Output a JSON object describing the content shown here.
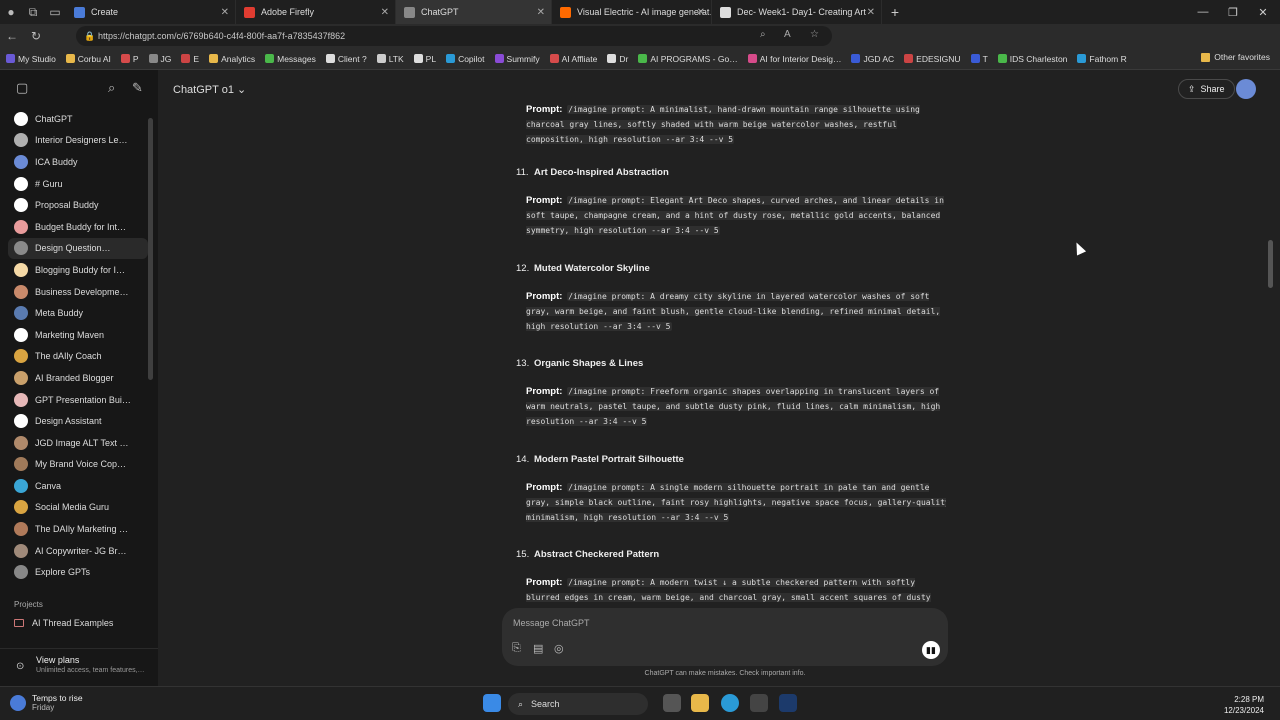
{
  "browser": {
    "tabs": [
      {
        "title": "Create",
        "color": "#4a7bd8"
      },
      {
        "title": "Adobe Firefly",
        "color": "#e03c31"
      },
      {
        "title": "ChatGPT",
        "color": "#888888"
      },
      {
        "title": "Visual Electric - AI image generat…",
        "color": "#ff6a00"
      },
      {
        "title": "Dec- Week1- Day1- Creating Art",
        "color": "#dddddd"
      }
    ],
    "url": "https://chatgpt.com/c/6769b640-c4f4-800f-aa7f-a7835437f862",
    "bookmarks": [
      "My Studio",
      "Corbu AI",
      "P",
      "JG",
      "E",
      "Analytics",
      "Messages",
      "Client ?",
      "LTK",
      "PL",
      "Copilot",
      "Summify",
      "AI Affliate",
      "Dr",
      "AI PROGRAMS - Go…",
      "AI for Interior Desig…",
      "JGD AC",
      "EDESIGNU",
      "T",
      "IDS Charleston",
      "Fathom R"
    ],
    "other_favorites": "Other favorites"
  },
  "sidebar": {
    "items": [
      {
        "label": "ChatGPT",
        "color": "#ffffff"
      },
      {
        "label": "Interior Designers Le…",
        "color": "#b0b0b0"
      },
      {
        "label": "ICA Buddy",
        "color": "#6b8bd6"
      },
      {
        "label": "# Guru",
        "color": "#ffffff"
      },
      {
        "label": "Proposal Buddy",
        "color": "#ffffff"
      },
      {
        "label": "Budget Buddy for Int…",
        "color": "#e89b9b"
      },
      {
        "label": "Design Question…",
        "color": "#8a8a8a"
      },
      {
        "label": "Blogging Buddy for I…",
        "color": "#f5d9a6"
      },
      {
        "label": "Business Developme…",
        "color": "#c98a6b"
      },
      {
        "label": "Meta Buddy",
        "color": "#5a7bb0"
      },
      {
        "label": "Marketing Maven",
        "color": "#ffffff"
      },
      {
        "label": "The dAIly Coach",
        "color": "#d9a441"
      },
      {
        "label": "AI Branded Blogger",
        "color": "#c9a06b"
      },
      {
        "label": "GPT Presentation Bui…",
        "color": "#e6b8b8"
      },
      {
        "label": "Design Assistant",
        "color": "#ffffff"
      },
      {
        "label": "JGD Image ALT Text …",
        "color": "#b08a6b"
      },
      {
        "label": "My Brand Voice Cop…",
        "color": "#a07a5a"
      },
      {
        "label": "Canva",
        "color": "#3aa6d6"
      },
      {
        "label": "Social Media Guru",
        "color": "#d9a441"
      },
      {
        "label": "The DAIly Marketing …",
        "color": "#b07a5a"
      },
      {
        "label": "AI Copywriter- JG Br…",
        "color": "#a08a7a"
      },
      {
        "label": "Explore GPTs",
        "color": "#888888"
      }
    ],
    "projects_label": "Projects",
    "project_item": "AI Thread Examples",
    "plans_title": "View plans",
    "plans_subtitle": "Unlimited access, team features,…"
  },
  "main": {
    "model": "ChatGPT o1",
    "share": "Share",
    "prompt_label": "Prompt:",
    "top_prompt": "/imagine prompt: A minimalist, hand-drawn mountain range silhouette using charcoal gray lines, softly shaded with warm beige watercolor washes, restful composition, high resolution --ar 3:4 --v 5",
    "items": [
      {
        "num": "11.",
        "title": "Art Deco-Inspired Abstraction",
        "prompt": "/imagine prompt: Elegant Art Deco shapes, curved arches, and linear details in soft taupe, champagne cream, and a hint of dusty rose, metallic gold accents, balanced symmetry, high resolution --ar 3:4 --v 5"
      },
      {
        "num": "12.",
        "title": "Muted Watercolor Skyline",
        "prompt": "/imagine prompt: A dreamy city skyline in layered watercolor washes of soft gray, warm beige, and faint blush, gentle cloud-like blending, refined minimal detail, high resolution --ar 3:4 --v 5"
      },
      {
        "num": "13.",
        "title": "Organic Shapes & Lines",
        "prompt": "/imagine prompt: Freeform organic shapes overlapping in translucent layers of warm neutrals, pastel taupe, and subtle dusty pink, fluid lines, calm minimalism, high resolution --ar 3:4 --v 5"
      },
      {
        "num": "14.",
        "title": "Modern Pastel Portrait Silhouette",
        "prompt": "/imagine prompt: A single modern silhouette portrait in pale tan and gentle gray, simple black outline, faint rosy highlights, negative space focus, gallery-quality minimalism, high resolution --ar 3:4 --v 5"
      },
      {
        "num": "15.",
        "title": "Abstract Checkered Pattern",
        "prompt": "/imagine prompt: A modern twist ↓ a subtle checkered pattern with softly blurred edges in cream, warm beige, and charcoal gray, small accent squares of dusty rose,"
      }
    ],
    "composer_placeholder": "Message ChatGPT",
    "disclaimer": "ChatGPT can make mistakes. Check important info."
  },
  "taskbar": {
    "weather_title": "Temps to rise",
    "weather_sub": "Friday",
    "search": "Search",
    "time": "2:28 PM",
    "date": "12/23/2024"
  }
}
